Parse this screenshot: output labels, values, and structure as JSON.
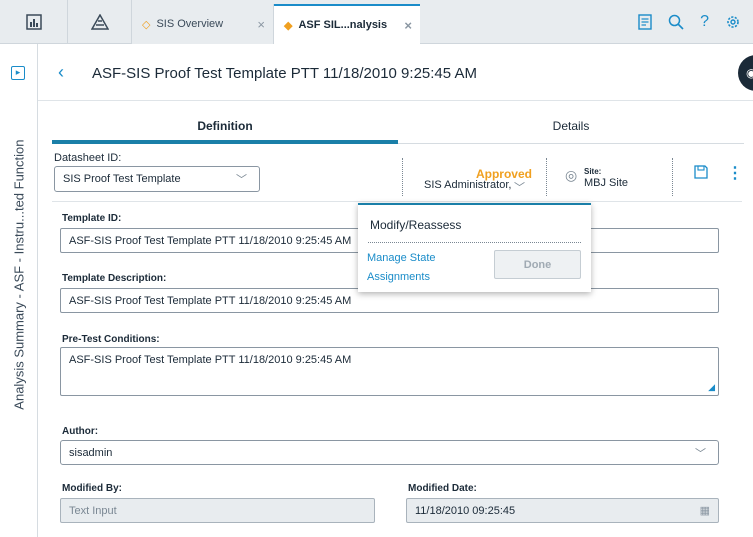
{
  "tabs": {
    "tab1_label": "SIS Overview",
    "tab2_label": "ASF SIL...nalysis",
    "close_glyph": "×"
  },
  "rail": {
    "vertical_title": "Analysis Summary - ASF - Instru...ted Function"
  },
  "header": {
    "title": "ASF-SIS Proof Test Template PTT 11/18/2010 9:25:45 AM"
  },
  "section_tabs": {
    "definition": "Definition",
    "details": "Details"
  },
  "datasheet": {
    "label": "Datasheet ID:",
    "value": "SIS Proof Test Template"
  },
  "state": {
    "status": "Approved",
    "user": "SIS Administrator,"
  },
  "site": {
    "label": "Site:",
    "value": "MBJ Site"
  },
  "fields": {
    "template_id_label": "Template ID:",
    "template_id_value": "ASF-SIS Proof Test Template PTT 11/18/2010 9:25:45 AM",
    "template_desc_label": "Template Description:",
    "template_desc_value": "ASF-SIS Proof Test Template PTT 11/18/2010 9:25:45 AM",
    "pretest_label": "Pre-Test Conditions:",
    "pretest_value": "ASF-SIS Proof Test Template PTT 11/18/2010 9:25:45 AM",
    "author_label": "Author:",
    "author_value": "sisadmin",
    "modified_by_label": "Modified By:",
    "modified_by_placeholder": "Text Input",
    "modified_date_label": "Modified Date:",
    "modified_date_value": "11/18/2010 09:25:45"
  },
  "popup": {
    "title": "Modify/Reassess",
    "manage_link": "Manage State Assignments",
    "done_label": "Done"
  },
  "icons": {
    "dashboard": "dashboard-icon",
    "triangle": "hazard-triangle-icon",
    "notes": "notes-icon",
    "search": "search-icon",
    "help": "help-icon",
    "settings": "gear-icon"
  },
  "colors": {
    "accent": "#1a8cc9",
    "approved": "#f0a020",
    "tab_underline": "#1a7fa8"
  }
}
